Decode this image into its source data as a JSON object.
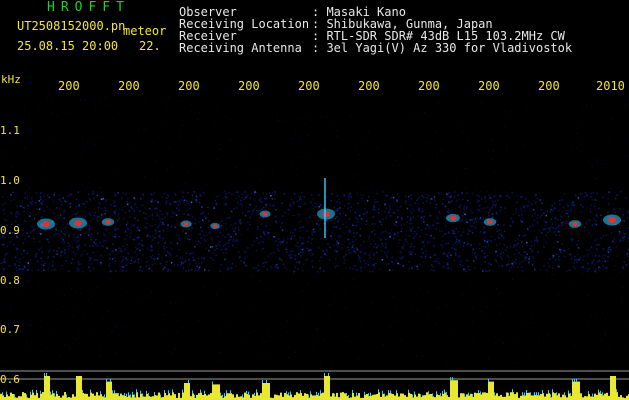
{
  "header": {
    "app_title": "HROFFT",
    "filename": "UT2508152000.pn",
    "mode": "meteor",
    "timestamp": "25.08.15 20:00",
    "count": "22.",
    "info": [
      {
        "label": "Observer",
        "value": ": Masaki Kano"
      },
      {
        "label": "Receiving Location",
        "value": ": Shibukawa, Gunma, Japan"
      },
      {
        "label": "Receiver",
        "value": ": RTL-SDR SDR# 43dB L15 103.2MHz CW"
      },
      {
        "label": "Receiving Antenna",
        "value": ": 3el Yagi(V) Az 330 for Vladivostok"
      }
    ]
  },
  "axis": {
    "unit": "kHz",
    "time_ticks": [
      "200",
      "200",
      "200",
      "200",
      "200",
      "200",
      "200",
      "200",
      "200",
      "2010"
    ],
    "freq_ticks": [
      "1.1",
      "1.0",
      "0.9",
      "0.8",
      "0.7",
      "0.6"
    ]
  },
  "colors": {
    "background": "#000000",
    "noise": "#0a1a7a",
    "meteor_core": "#ff2a2a",
    "meteor_halo": "#2fd2ff",
    "power_trace": "#e8e832",
    "grid_line": "#9a9a9a"
  }
}
